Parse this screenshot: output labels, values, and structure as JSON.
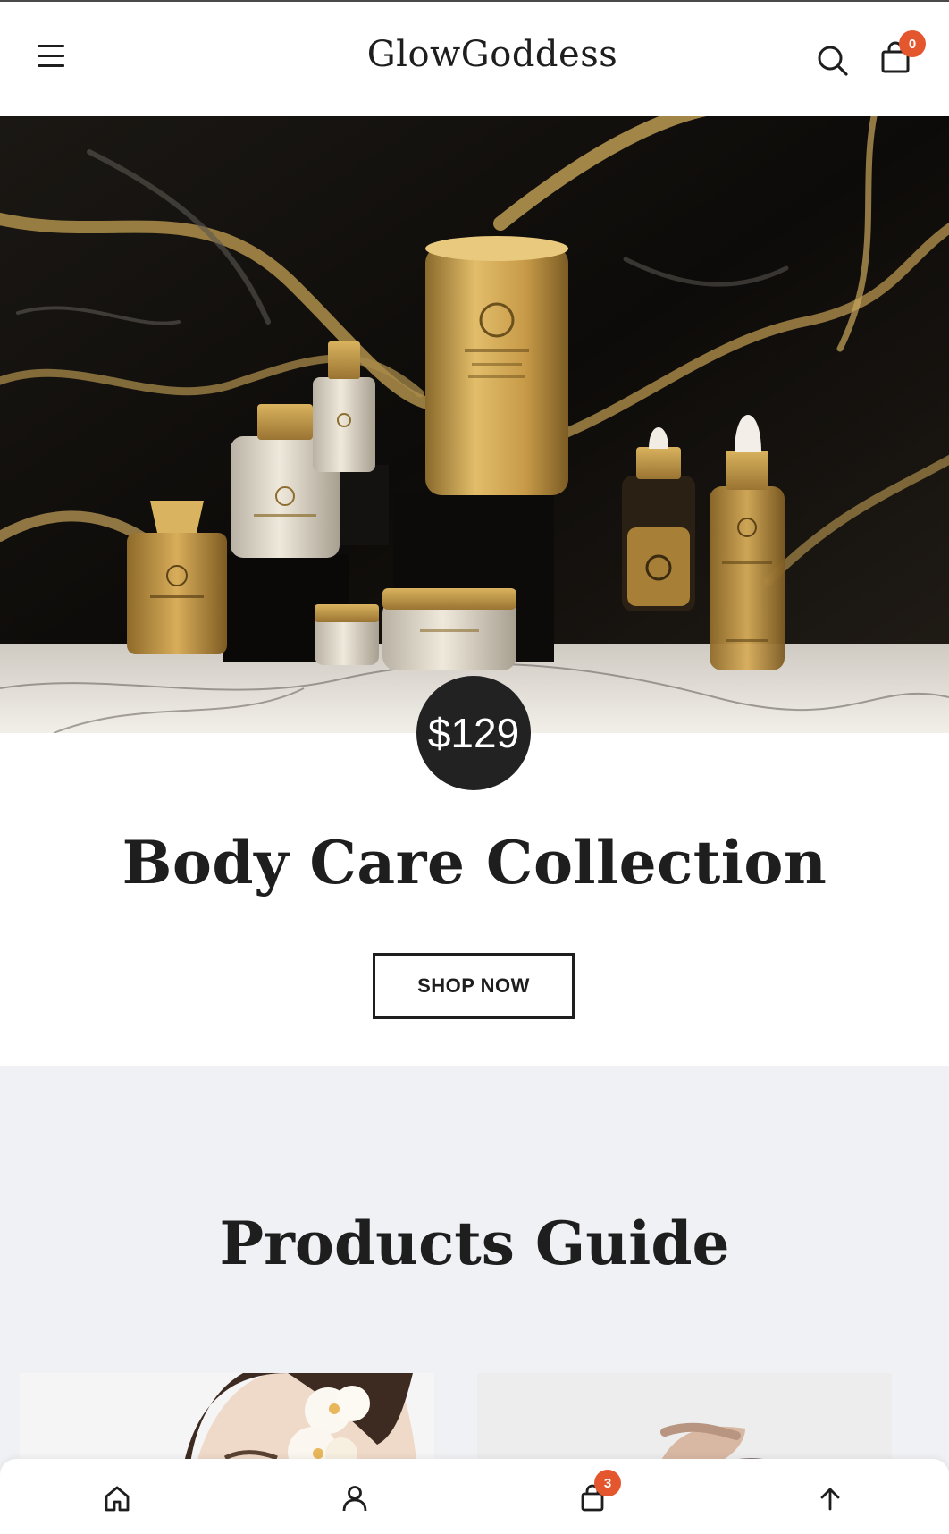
{
  "header": {
    "brand": "GlowGoddess",
    "cart_count": "0",
    "icons": {
      "menu": "hamburger-menu-icon",
      "search": "search-icon",
      "cart": "shopping-bag-icon"
    }
  },
  "hero": {
    "image": "luxury-gold-cosmetics-on-black-marble",
    "price": "$129",
    "title": "Body Care Collection",
    "cta_label": "SHOP NOW"
  },
  "guide": {
    "title": "Products Guide",
    "cards": [
      {
        "image": "woman-with-orchid-flowers"
      },
      {
        "image": "woman-touching-hair"
      }
    ]
  },
  "bottom_nav": {
    "items": [
      {
        "icon": "home-icon"
      },
      {
        "icon": "account-icon"
      },
      {
        "icon": "shopping-bag-icon",
        "badge": "3"
      },
      {
        "icon": "arrow-up-icon"
      }
    ]
  },
  "colors": {
    "accent_badge": "#e4572e",
    "text": "#1e1e1e",
    "price_circle": "#222222",
    "guide_background": "#f0f1f4"
  }
}
